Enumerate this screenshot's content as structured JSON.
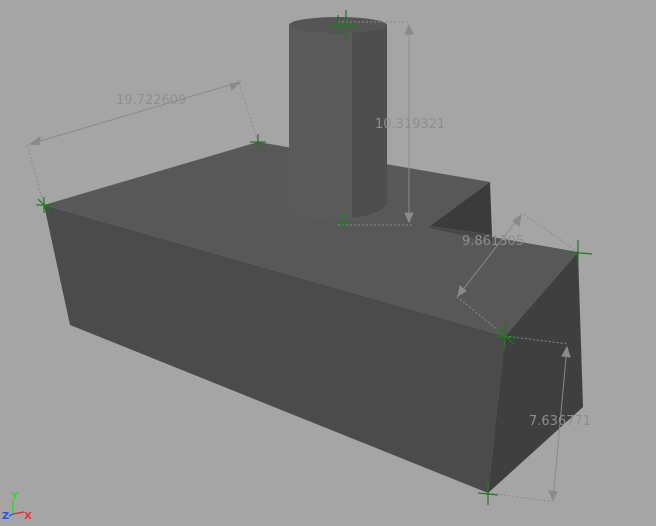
{
  "viewport": {
    "background_color": "#a5a5a5",
    "object_face_colors": {
      "light": "#5a5a5a",
      "mid": "#4c4c4c",
      "dark": "#434343"
    },
    "locator_color": "#1e7a1e",
    "dimension_line_color": "#8a8a8a"
  },
  "dimensions": [
    {
      "id": "top-width",
      "value": "19.722609"
    },
    {
      "id": "cylinder-height",
      "value": "10.319321"
    },
    {
      "id": "top-depth",
      "value": "9.861305"
    },
    {
      "id": "block-height",
      "value": "7.636771"
    }
  ],
  "axis_gizmo": {
    "y_label": "Y",
    "z_label": "Z",
    "x_label": "X",
    "y_color": "#2bdc2b",
    "z_color": "#2a52e6",
    "x_color": "#e63232"
  }
}
